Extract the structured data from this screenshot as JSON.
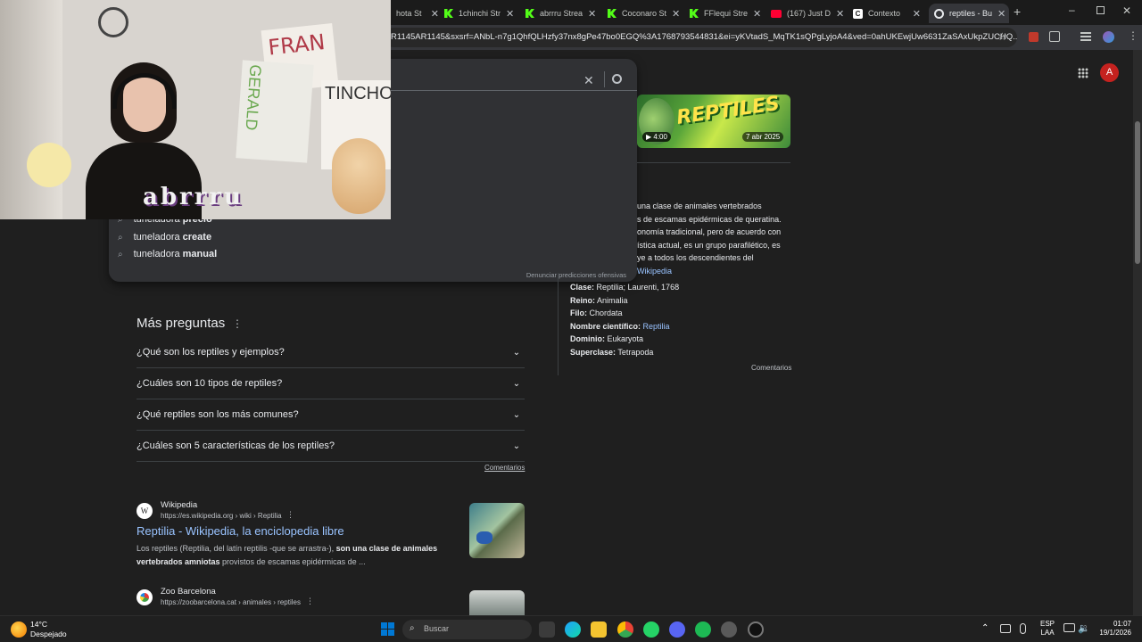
{
  "tabs": [
    {
      "label": "hota St"
    },
    {
      "label": "1chinchi Str"
    },
    {
      "label": "abrrru Strea"
    },
    {
      "label": "Coconaro St"
    },
    {
      "label": "FFlequi Stre"
    },
    {
      "label": "(167) Just D"
    },
    {
      "label": "Contexto"
    },
    {
      "label": "reptiles - Bu"
    }
  ],
  "address": {
    "url": "R1145AR1145&sxsrf=ANbL-n7g1QhfQLHzfy37nx8gPe47bo0EGQ%3A1768793544831&ei=yKVtadS_MqTK1sQPgLyjoA4&ved=0ahUKEwjUw6631ZaSAxUkpZUCHQ..."
  },
  "avatar_letter": "A",
  "webcam": {
    "overlay_text": "abrrru",
    "sign_1": "FRAN",
    "sign_2": "GERALD",
    "sign_3": "TINCHO"
  },
  "suggestions": [
    {
      "prefix": "tuneladora ",
      "bold": "precio"
    },
    {
      "prefix": "tuneladora ",
      "bold": "create"
    },
    {
      "prefix": "tuneladora ",
      "bold": "manual"
    }
  ],
  "report_link": "Denunciar predicciones ofensivas",
  "paa": {
    "title": "Más preguntas",
    "questions": [
      "¿Qué son los reptiles y ejemplos?",
      "¿Cuáles son 10 tipos de reptiles?",
      "¿Qué reptiles son los más comunes?",
      "¿Cuáles son 5 características de los reptiles?"
    ],
    "feedback": "Comentarios"
  },
  "results": [
    {
      "site": "Wikipedia",
      "url": "https://es.wikipedia.org › wiki › Reptilia",
      "title": "Reptilia - Wikipedia, la enciclopedia libre",
      "snippet_a": "Los reptiles (Reptilia, del latín reptilis -que se arrastra-), ",
      "snippet_b": "son una clase de animales vertebrados amniotas",
      "snippet_c": " provistos de escamas epidérmicas de ..."
    },
    {
      "site": "Zoo Barcelona",
      "url": "https://zoobarcelona.cat › animales › reptiles"
    }
  ],
  "video": {
    "duration": "4:00",
    "date": "7 abr 2025",
    "banner": "REPTILES"
  },
  "kp": {
    "desc_lines": [
      "una clase de animales vertebrados",
      "s de escamas epidérmicas de queratina.",
      "onomía tradicional, pero de acuerdo con",
      "ística actual, es un grupo parafilético, es",
      "ye a todos los descendientes del"
    ],
    "source": "Wikipedia",
    "facts": [
      {
        "k": "Clase:",
        "v": " Reptilia; Laurenti, 1768"
      },
      {
        "k": "Reino:",
        "v": " Animalia"
      },
      {
        "k": "Filo:",
        "v": " Chordata"
      },
      {
        "k": "Nombre científico:",
        "v": " Reptilia"
      },
      {
        "k": "Dominio:",
        "v": " Eukaryota"
      },
      {
        "k": "Superclase:",
        "v": " Tetrapoda"
      }
    ],
    "feedback": "Comentarios"
  },
  "taskbar": {
    "temp": "14°C",
    "weather": "Despejado",
    "search_placeholder": "Buscar",
    "lang_1": "ESP",
    "lang_2": "LAA",
    "time": "01:07",
    "date": "19/1/2026"
  }
}
